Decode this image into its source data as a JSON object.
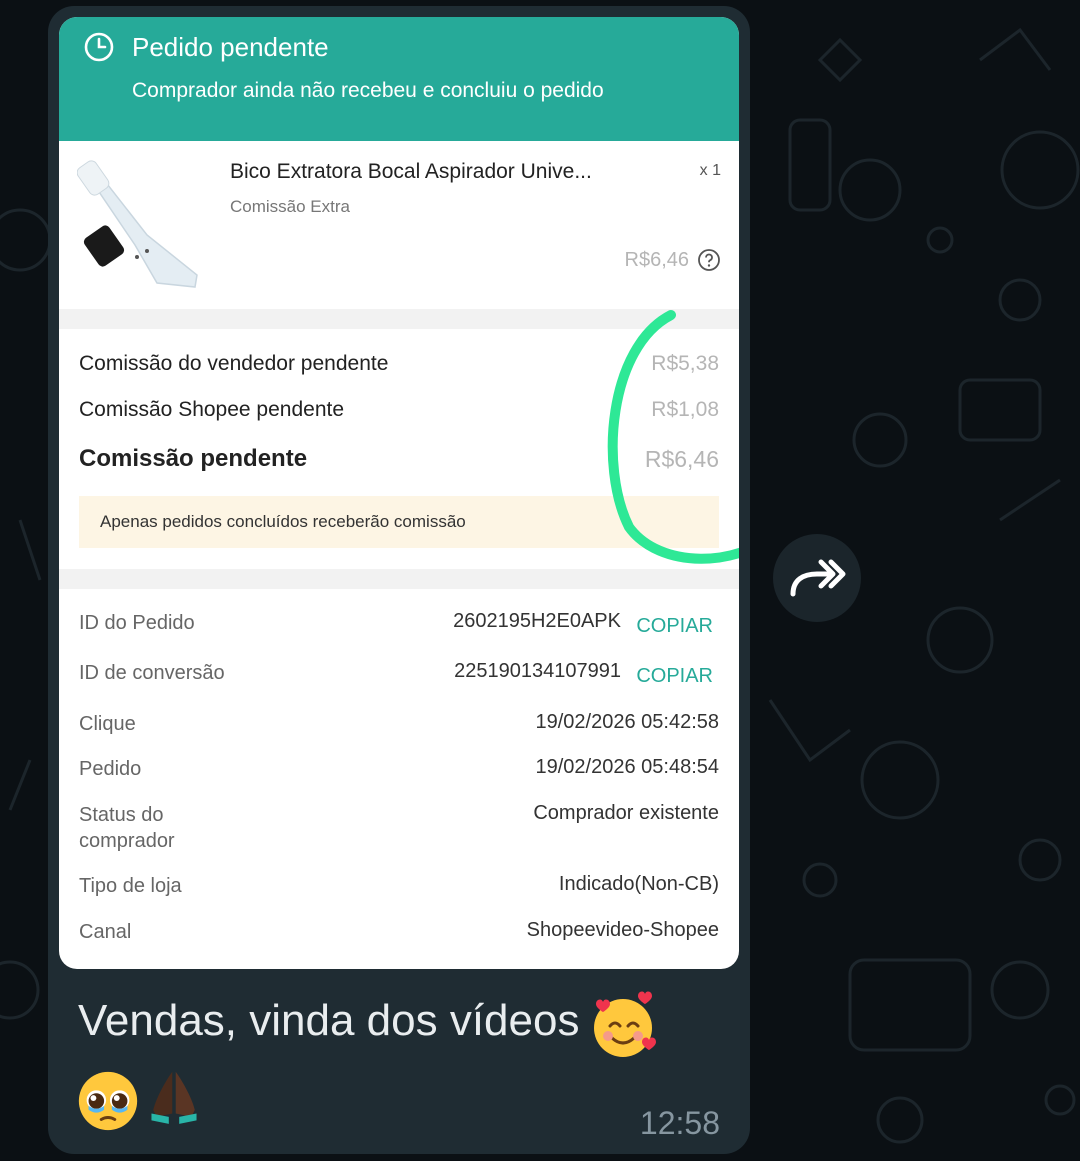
{
  "order": {
    "status_title": "Pedido pendente",
    "status_subtitle": "Comprador ainda não recebeu e concluiu o pedido",
    "product": {
      "name": "Bico Extratora Bocal Aspirador Unive...",
      "tag": "Comissão Extra",
      "quantity": "x 1",
      "price": "R$6,46"
    },
    "commission": [
      {
        "label": "Comissão do vendedor pendente",
        "value": "R$5,38"
      },
      {
        "label": "Comissão Shopee pendente",
        "value": "R$1,08"
      },
      {
        "label": "Comissão pendente",
        "value": "R$6,46"
      }
    ],
    "notice": "Apenas pedidos concluídos receberão comissão",
    "details": [
      {
        "label": "ID do Pedido",
        "value": "2602195H2E0APK",
        "action": "COPIAR"
      },
      {
        "label": "ID de conversão",
        "value": "225190134107991",
        "action": "COPIAR"
      },
      {
        "label": "Clique",
        "value": "19/02/2026 05:42:58"
      },
      {
        "label": "Pedido",
        "value": "19/02/2026 05:48:54"
      },
      {
        "label": "Status do comprador",
        "value": "Comprador existente"
      },
      {
        "label": "Tipo de loja",
        "value": "Indicado(Non-CB)"
      },
      {
        "label": "Canal",
        "value": "Shopeevideo-Shopee"
      }
    ]
  },
  "message": {
    "caption": "Vendas, vinda dos vídeos",
    "time": "12:58",
    "emojis": [
      "smiling-face-with-hearts",
      "pleading-face",
      "folded-hands"
    ]
  },
  "colors": {
    "shopee_header": "#26aa99",
    "copy_link": "#26aa99",
    "bubble": "#1f2c33",
    "annotation_stroke": "#2ee896"
  }
}
